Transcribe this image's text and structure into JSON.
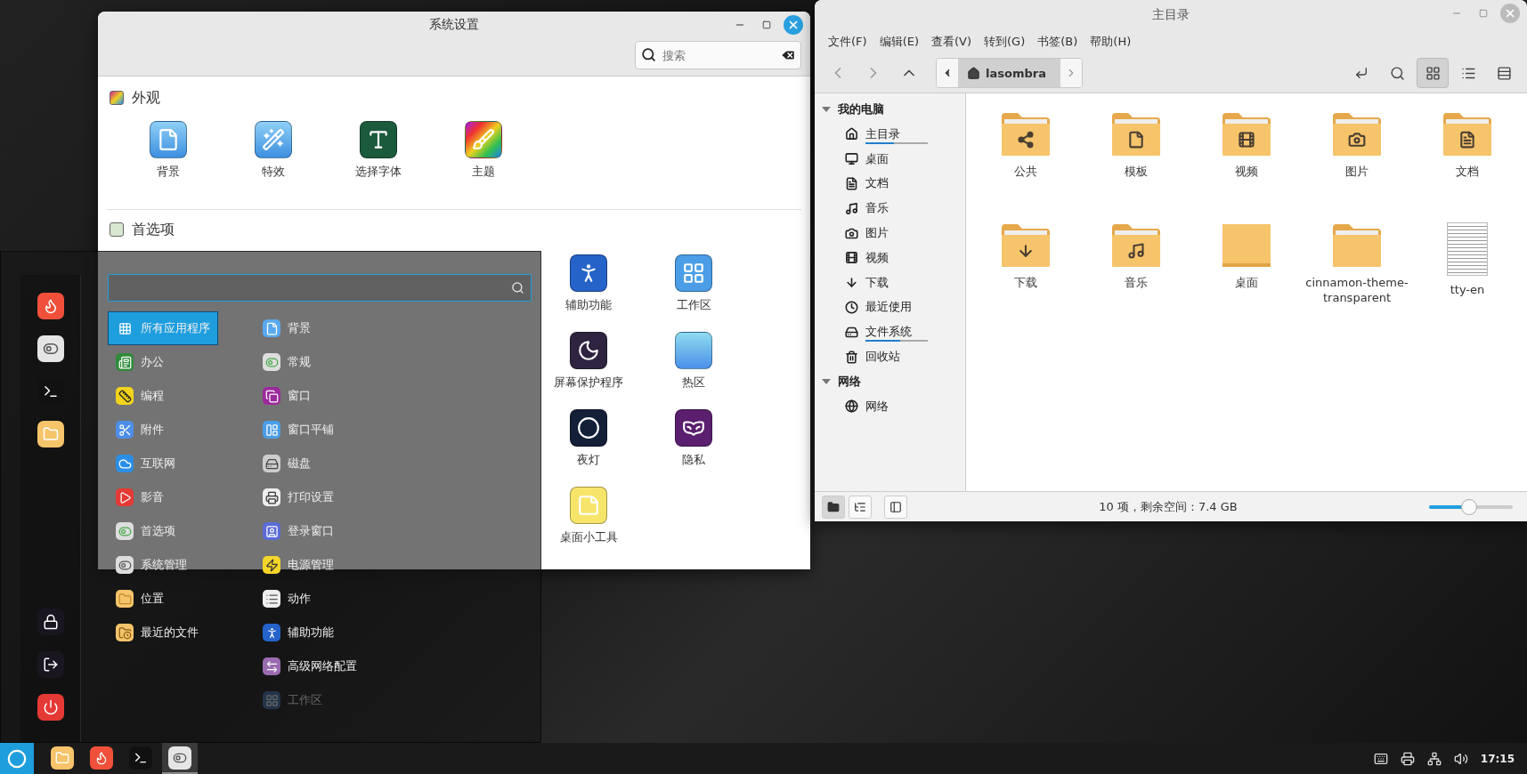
{
  "settings_window": {
    "title": "系统设置",
    "search": {
      "placeholder": "搜索"
    },
    "sections": [
      {
        "title": "外观",
        "items": [
          {
            "label": "背景"
          },
          {
            "label": "特效"
          },
          {
            "label": "选择字体"
          },
          {
            "label": "主题"
          }
        ]
      },
      {
        "title": "首选项",
        "items": [
          {
            "label": "辅助功能"
          },
          {
            "label": "工作区"
          },
          {
            "label": "屏幕保护程序"
          },
          {
            "label": "热区"
          },
          {
            "label": "夜灯"
          },
          {
            "label": "隐私"
          },
          {
            "label": "桌面小工具"
          }
        ]
      }
    ]
  },
  "menu": {
    "categories": [
      {
        "label": "所有应用程序",
        "selected": true
      },
      {
        "label": "办公",
        "selected": false
      },
      {
        "label": "编程",
        "selected": false
      },
      {
        "label": "附件",
        "selected": false
      },
      {
        "label": "互联网",
        "selected": false
      },
      {
        "label": "影音",
        "selected": false
      },
      {
        "label": "首选项",
        "selected": false
      },
      {
        "label": "系统管理",
        "selected": false
      },
      {
        "label": "位置",
        "selected": false
      },
      {
        "label": "最近的文件",
        "selected": false
      }
    ],
    "apps": [
      {
        "label": "背景",
        "faded": false
      },
      {
        "label": "常规",
        "faded": false
      },
      {
        "label": "窗口",
        "faded": false
      },
      {
        "label": "窗口平铺",
        "faded": false
      },
      {
        "label": "磁盘",
        "faded": false
      },
      {
        "label": "打印设置",
        "faded": false
      },
      {
        "label": "登录窗口",
        "faded": false
      },
      {
        "label": "电源管理",
        "faded": false
      },
      {
        "label": "动作",
        "faded": false
      },
      {
        "label": "辅助功能",
        "faded": false
      },
      {
        "label": "高级网络配置",
        "faded": false
      },
      {
        "label": "工作区",
        "faded": true
      }
    ]
  },
  "file_manager": {
    "title": "主目录",
    "menu": [
      "文件(F)",
      "编辑(E)",
      "查看(V)",
      "转到(G)",
      "书签(B)",
      "帮助(H)"
    ],
    "path": "lasombra",
    "views": [
      {
        "selected": true
      },
      {
        "selected": false
      },
      {
        "selected": false
      }
    ],
    "sidebar": [
      {
        "title": "我的电脑",
        "expanded": true,
        "children": [
          {
            "label": "主目录",
            "level": 0.45
          },
          {
            "label": "桌面"
          },
          {
            "label": "文档"
          },
          {
            "label": "音乐"
          },
          {
            "label": "图片"
          },
          {
            "label": "视频"
          },
          {
            "label": "下载"
          },
          {
            "label": "最近使用"
          },
          {
            "label": "文件系统",
            "level": 0.55
          },
          {
            "label": "回收站"
          }
        ]
      },
      {
        "title": "网络",
        "expanded": true,
        "children": [
          {
            "label": "网络"
          }
        ]
      }
    ],
    "files": [
      {
        "label": "公共"
      },
      {
        "label": "模板"
      },
      {
        "label": "视频"
      },
      {
        "label": "图片"
      },
      {
        "label": "文档"
      },
      {
        "label": "下载"
      },
      {
        "label": "音乐"
      },
      {
        "label": "桌面"
      },
      {
        "label": "cinnamon-theme-transparent"
      },
      {
        "label": "tty-en"
      }
    ],
    "status": "10 项，剩余空间：7.4 GB",
    "zoom": {
      "level": 0.48
    }
  },
  "taskbar": {
    "apps": [
      {
        "active": false
      },
      {
        "active": false
      },
      {
        "active": false
      },
      {
        "active": true
      }
    ],
    "clock": "17:15"
  }
}
